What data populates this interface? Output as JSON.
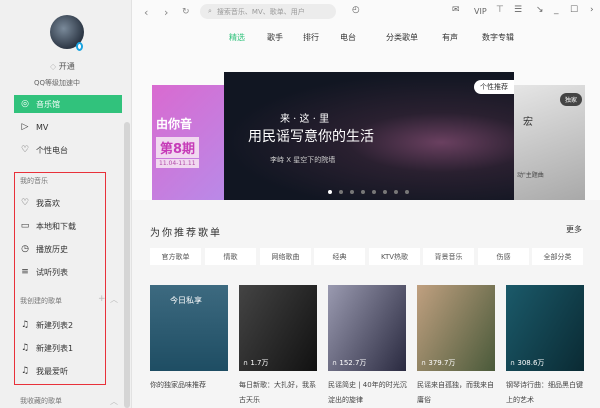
{
  "sidebar": {
    "open_label": "开通",
    "level_text": "QQ等级加速中",
    "nav": [
      {
        "label": "音乐馆",
        "icon": "music-hall-icon"
      },
      {
        "label": "MV",
        "icon": "mv-icon"
      },
      {
        "label": "个性电台",
        "icon": "radio-icon"
      }
    ],
    "my_music_header": "我的音乐",
    "my_music": [
      {
        "label": "我喜欢",
        "icon": "heart-icon"
      },
      {
        "label": "本地和下载",
        "icon": "computer-icon"
      },
      {
        "label": "播放历史",
        "icon": "clock-icon"
      },
      {
        "label": "试听列表",
        "icon": "playlist-icon"
      }
    ],
    "created_header": "我创建的歌单",
    "created": [
      {
        "label": "新建列表2"
      },
      {
        "label": "新建列表1"
      },
      {
        "label": "我最爱听"
      }
    ],
    "collected_header": "我收藏的歌单"
  },
  "topbar": {
    "search_placeholder": "搜索音乐、MV、歌单、用户",
    "vip": "VIP"
  },
  "tabs": [
    "精选",
    "歌手",
    "排行",
    "电台",
    "分类歌单",
    "有声",
    "数字专辑"
  ],
  "banner": {
    "left_title": "由你音",
    "left_issue": "第8期",
    "left_date": "11.04-11.11",
    "main_line1": "来 · 这 · 里",
    "main_line2": "用民谣写意你的生活",
    "main_sub": "李峙 X 星空下的院墙",
    "main_badge": "个性推荐",
    "right_badge": "独家",
    "right_title": "宏",
    "right_sub": "动\"主题曲"
  },
  "section": {
    "title": "为你推荐歌单",
    "more": "更多",
    "chips": [
      "官方歌单",
      "情歌",
      "网络歌曲",
      "经典",
      "KTV热歌",
      "背景音乐",
      "伤感",
      "全部分类"
    ],
    "cards": [
      {
        "cover": "今日私享",
        "plays": "",
        "caption": "你的独家品味推荐"
      },
      {
        "plays": "1.7万",
        "caption": "每日新歌：大扎好，我系古天乐"
      },
      {
        "plays": "152.7万",
        "caption": "民谣简史 | 40年的时光沉淀出的旋律"
      },
      {
        "plays": "379.7万",
        "caption": "民谣来自孤独，而我来自庸俗"
      },
      {
        "plays": "308.6万",
        "caption": "钢琴诗行曲：细品黑白键上的艺术"
      }
    ]
  }
}
